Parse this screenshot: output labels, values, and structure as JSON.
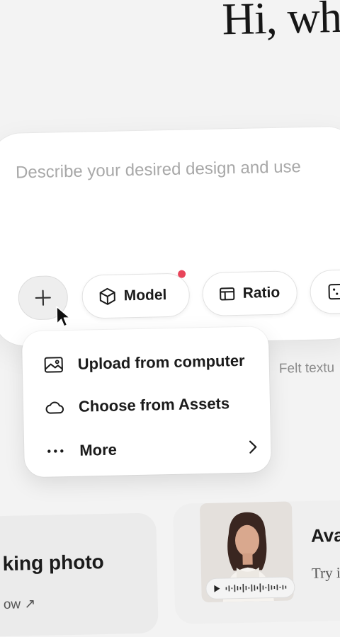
{
  "greeting": "Hi, wh",
  "prompt": {
    "placeholder": "Describe your desired design and use"
  },
  "toolbar": {
    "add_icon": "plus-icon",
    "model_label": "Model",
    "model_icon": "cube-icon",
    "model_has_notification": true,
    "ratio_label": "Ratio",
    "ratio_icon": "ratio-icon",
    "extra_icon": "square-icon"
  },
  "attach_menu": {
    "items": [
      {
        "label": "Upload from computer",
        "icon": "image-icon"
      },
      {
        "label": "Choose from Assets",
        "icon": "cloud-icon"
      },
      {
        "label": "More",
        "icon": "ellipsis-icon",
        "has_submenu": true
      }
    ]
  },
  "suggestions": {
    "side_label": "Felt textu",
    "cards": [
      {
        "title": "king photo",
        "link": "ow ↗"
      },
      {
        "title": "Avat",
        "subtitle": "Try it"
      }
    ]
  },
  "colors": {
    "background": "#f3f3f3",
    "card": "#ffffff",
    "notification": "#e8455a",
    "placeholder": "#a8a8a8"
  }
}
